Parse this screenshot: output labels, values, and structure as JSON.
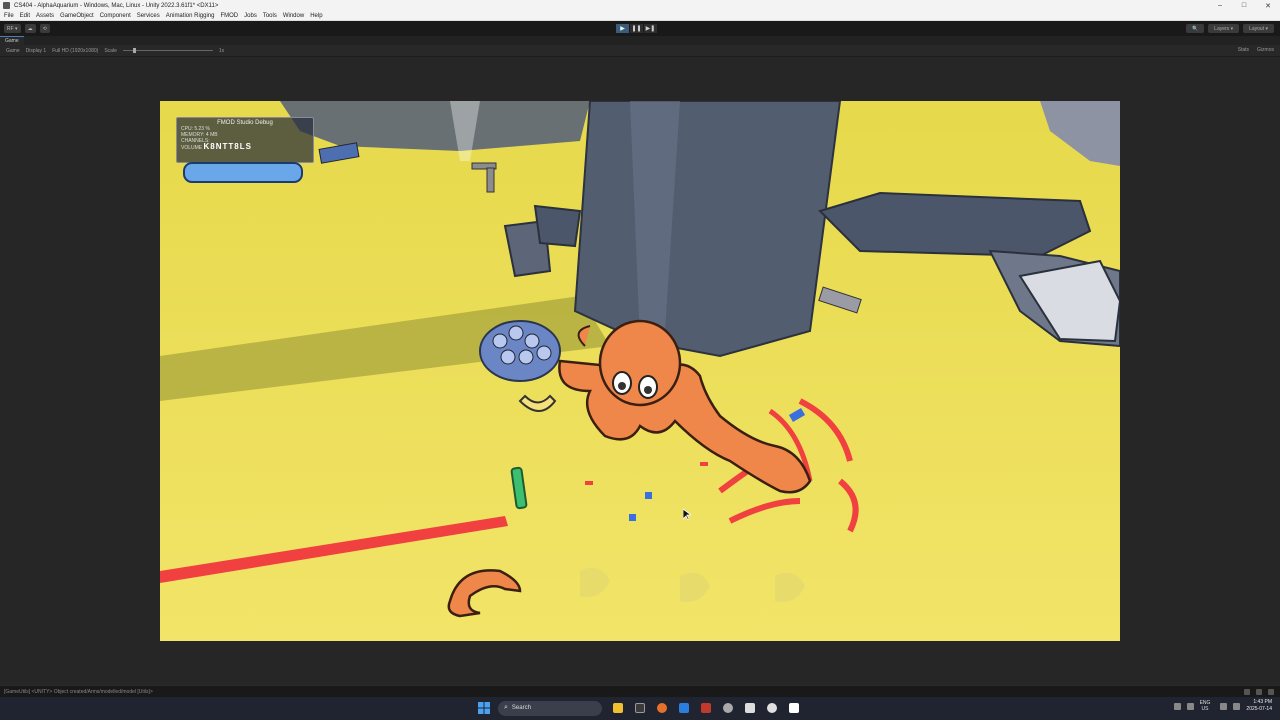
{
  "window": {
    "title": "CS404 - AlphaAquarium - Windows, Mac, Linux - Unity 2022.3.61f1* <DX11>",
    "controls": {
      "minimize": "–",
      "maximize": "□",
      "close": "✕"
    }
  },
  "menu": [
    "File",
    "Edit",
    "Assets",
    "GameObject",
    "Component",
    "Services",
    "Animation Rigging",
    "FMOD",
    "Jobs",
    "Tools",
    "Window",
    "Help"
  ],
  "toolbar": {
    "left_buttons": [
      "RF ▾",
      "☁",
      "⟲"
    ],
    "play_controls": {
      "play": "▶",
      "pause": "❚❚",
      "step": "▶❚"
    },
    "right_buttons": [
      "🔍",
      "Layers ▾",
      "Layout ▾"
    ]
  },
  "tabs": [
    {
      "label": "Game",
      "icon": "gamepad-icon"
    }
  ],
  "gamebar": {
    "mode": "Game",
    "display": "Display 1",
    "resolution": "Full HD (1920x1080)",
    "scale_label": "Scale",
    "scale_value": "1x",
    "right": [
      "Stats",
      "Gizmos"
    ]
  },
  "fmod_debug": {
    "title": "FMOD Studio Debug",
    "rows": [
      "CPU: 5.23 %",
      "MEMORY: 4 MB",
      "CHANNELS:"
    ],
    "volume_label": "VOLUME",
    "volume_value": "K8NTT8LS"
  },
  "statusbar": {
    "text": "[GameUtils] <UNITY> Object created/Arms/modelled/model [Utils]>"
  },
  "taskbar": {
    "search_placeholder": "Search",
    "apps": [
      {
        "name": "file-explorer-icon",
        "color": "#f0c030"
      },
      {
        "name": "terminal-icon",
        "color": "#3a3a3a"
      },
      {
        "name": "firefox-icon",
        "color": "#e8712a"
      },
      {
        "name": "vscode-icon",
        "color": "#2b7de0"
      },
      {
        "name": "app-red-icon",
        "color": "#c0392b"
      },
      {
        "name": "settings-icon",
        "color": "#aaaaaa"
      },
      {
        "name": "unity-icon",
        "color": "#dddddd"
      },
      {
        "name": "github-icon",
        "color": "#e0e0e0"
      },
      {
        "name": "app-white-icon",
        "color": "#ffffff"
      }
    ],
    "lang": {
      "top": "ENG",
      "bottom": "US"
    },
    "time": "1:43 PM",
    "date": "2025-07-14"
  },
  "colors": {
    "sand": "#ece04e",
    "octopus": "#f0874a",
    "rock": "#50596b",
    "paint_red": "#f03a3a",
    "unity_dark": "#191919"
  }
}
